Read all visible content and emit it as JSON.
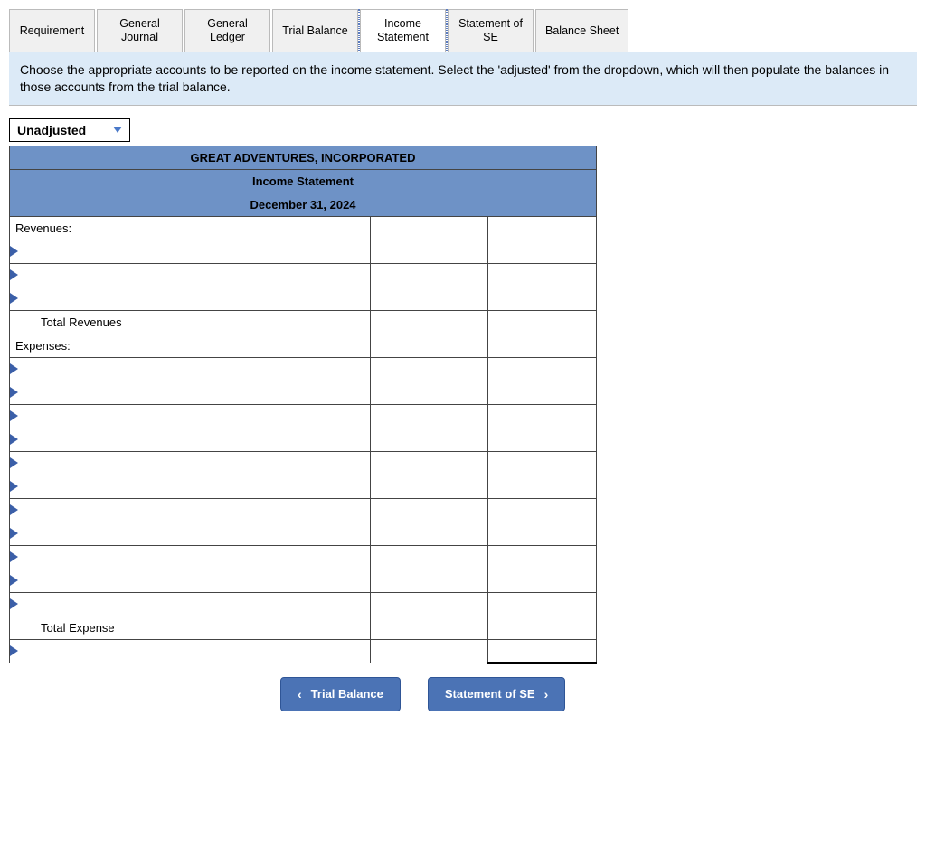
{
  "tabs": [
    {
      "label": "Requirement"
    },
    {
      "label": "General\nJournal"
    },
    {
      "label": "General\nLedger"
    },
    {
      "label": "Trial Balance"
    },
    {
      "label": "Income\nStatement"
    },
    {
      "label": "Statement of\nSE"
    },
    {
      "label": "Balance Sheet"
    }
  ],
  "instruction": "Choose the appropriate accounts to be reported on the income statement. Select the 'adjusted' from the dropdown, which will then populate the balances in those accounts from the trial balance.",
  "dropdown": {
    "value": "Unadjusted"
  },
  "statement": {
    "company": "GREAT ADVENTURES, INCORPORATED",
    "title": "Income Statement",
    "date": "December 31, 2024",
    "revenues_label": "Revenues:",
    "total_revenues_label": "Total Revenues",
    "expenses_label": "Expenses:",
    "total_expense_label": "Total Expense",
    "revenue_rows": 3,
    "expense_rows": 11
  },
  "nav": {
    "prev": "Trial Balance",
    "next": "Statement of SE"
  }
}
